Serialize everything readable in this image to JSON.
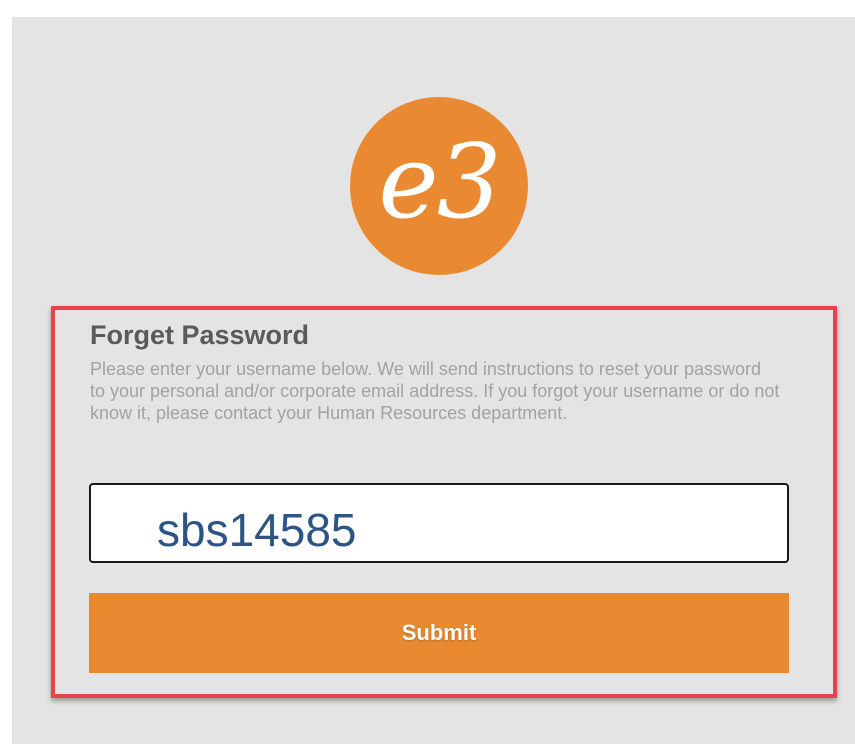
{
  "logo": {
    "text": "e3",
    "color": "#e98a32"
  },
  "form": {
    "title": "Forget Password",
    "description": "Please enter your username below. We will send instructions to reset your password to your personal and/or corporate email address. If you forgot your username or do not know it, please contact your Human Resources department.",
    "username_value": "sbs14585",
    "submit_label": "Submit"
  },
  "colors": {
    "accent": "#e98a32",
    "highlight_border": "#e8434b",
    "panel_background": "#e4e4e4",
    "input_text": "#2c5484"
  }
}
